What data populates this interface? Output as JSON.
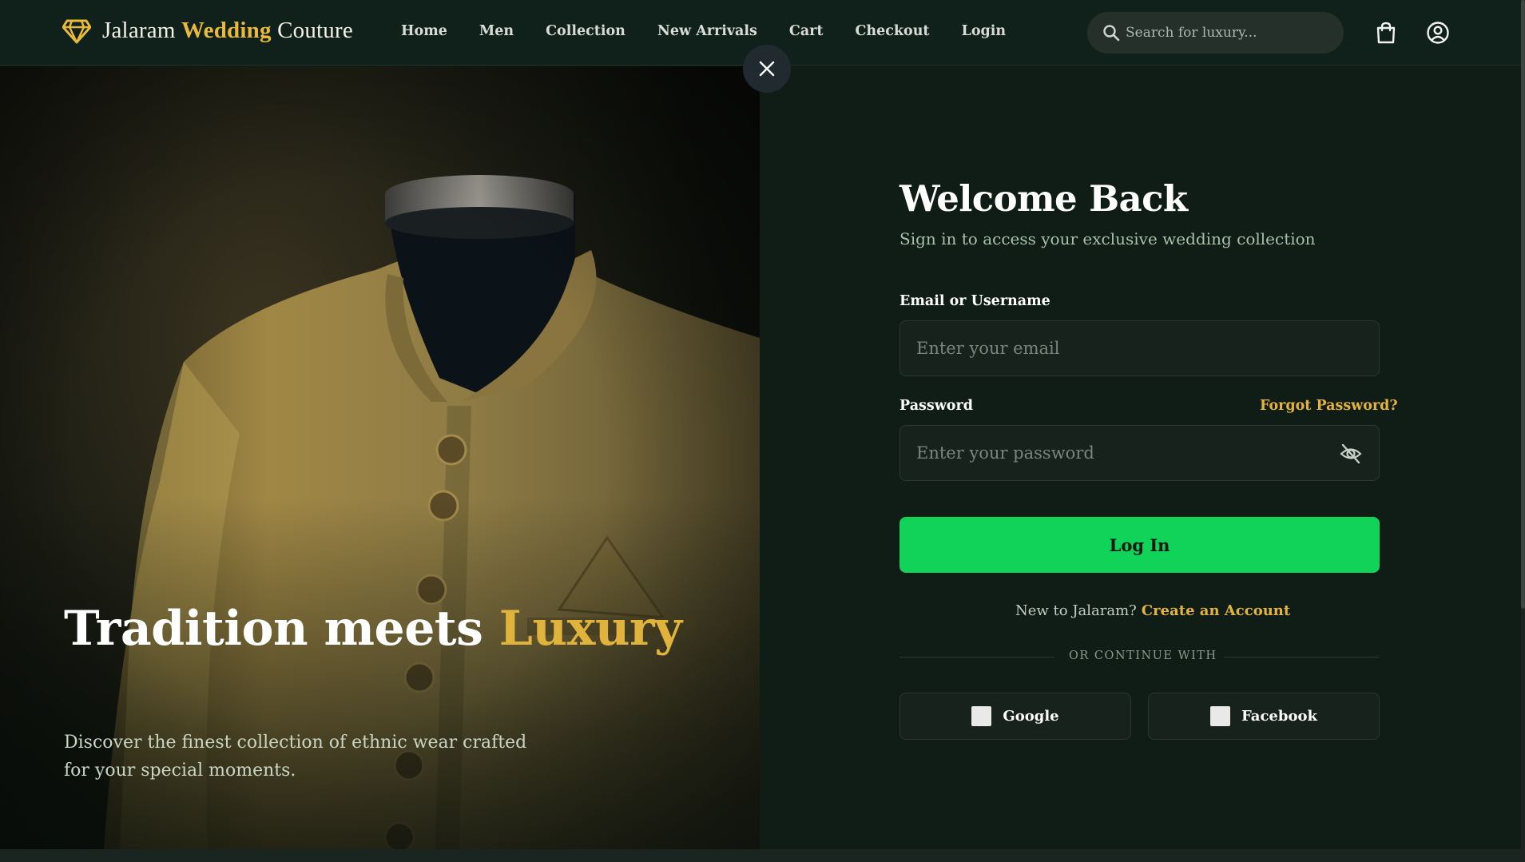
{
  "header": {
    "logo_text_1": "Jalaram",
    "logo_text_2": "Wedding",
    "logo_text_3": "Couture",
    "nav": [
      "Home",
      "Men",
      "Collection",
      "New Arrivals",
      "Cart",
      "Checkout",
      "Login"
    ],
    "search_placeholder": "Search for luxury...",
    "icons": [
      "diamond-icon",
      "search-icon",
      "shopping-bag-icon",
      "user-icon"
    ]
  },
  "hero": {
    "title_1": "Tradition meets",
    "title_2": "Luxury",
    "subtitle": "Discover the finest collection of ethnic wear crafted for your special moments."
  },
  "login": {
    "title": "Welcome Back",
    "subtitle": "Sign in to access your exclusive wedding collection",
    "email_label": "Email or Username",
    "email_placeholder": "Enter your email",
    "password_label": "Password",
    "forgot": "Forgot Password?",
    "password_placeholder": "Enter your password",
    "submit": "Log In",
    "new_prompt": "New to Jalaram?",
    "create": "Create an Account",
    "or": "OR CONTINUE WITH",
    "google": "Google",
    "facebook": "Facebook"
  },
  "colors": {
    "accent_gold": "#e4b43e",
    "primary_green": "#12d35a",
    "background": "#0f1d16"
  }
}
